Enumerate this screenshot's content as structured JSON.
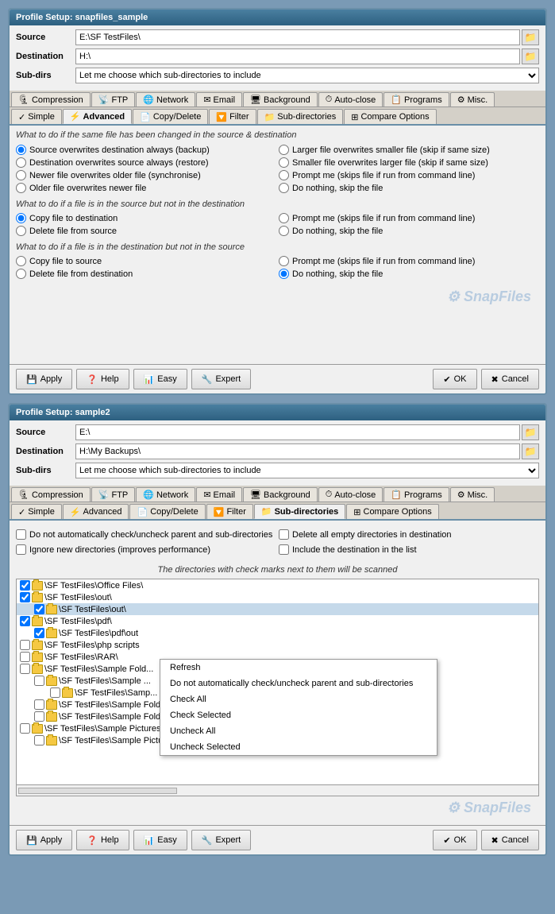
{
  "window1": {
    "title": "Profile Setup: snapfiles_sample",
    "source_label": "Source",
    "source_value": "E:\\SF TestFiles\\",
    "destination_label": "Destination",
    "destination_value": "H:\\",
    "subdirs_label": "Sub-dirs",
    "subdirs_value": "Let me choose which sub-directories to include",
    "tabs_row1": [
      {
        "label": "Compression",
        "icon": "🗜"
      },
      {
        "label": "FTP",
        "icon": "📡"
      },
      {
        "label": "Network",
        "icon": "🌐"
      },
      {
        "label": "Email",
        "icon": "✉"
      },
      {
        "label": "Background",
        "icon": "🖥"
      },
      {
        "label": "Auto-close",
        "icon": "⏱"
      },
      {
        "label": "Programs",
        "icon": "📋"
      },
      {
        "label": "Misc.",
        "icon": "⚙"
      }
    ],
    "tabs_row2": [
      {
        "label": "Simple",
        "icon": "✓",
        "active": false
      },
      {
        "label": "Advanced",
        "icon": "⚡",
        "active": true
      },
      {
        "label": "Copy/Delete",
        "icon": "📄",
        "active": false
      },
      {
        "label": "Filter",
        "icon": "🔽",
        "active": false
      },
      {
        "label": "Sub-directories",
        "icon": "📁",
        "active": false
      },
      {
        "label": "Compare Options",
        "icon": "⊞",
        "active": false
      }
    ],
    "section1_header": "What to do if the same file has been changed in the source & destination",
    "radio_groups": [
      {
        "options_left": [
          "Source overwrites destination always (backup)",
          "Destination overwrites source always (restore)",
          "Newer file overwrites older file (synchronise)",
          "Older file overwrites newer file"
        ],
        "options_right": [
          "Larger file overwrites smaller file (skip if same size)",
          "Smaller file overwrites larger file (skip if same size)",
          "Prompt me (skips file if run from command line)",
          "Do nothing, skip the file"
        ],
        "selected_left": 0,
        "selected_right": -1
      }
    ],
    "section2_header": "What to do if a file is in the source but not in the destination",
    "section2_left": [
      "Copy file to destination",
      "Delete file from source"
    ],
    "section2_right": [
      "Prompt me  (skips file if run from command line)",
      "Do nothing, skip the file"
    ],
    "section2_selected_left": 0,
    "section3_header": "What to do if a file is in the destination but not in the source",
    "section3_left": [
      "Copy file to source",
      "Delete file from destination"
    ],
    "section3_right": [
      "Prompt me  (skips file if run from command line)",
      "Do nothing, skip the file"
    ],
    "section3_selected_right": 1,
    "buttons": {
      "apply": "Apply",
      "help": "Help",
      "easy": "Easy",
      "expert": "Expert",
      "ok": "OK",
      "cancel": "Cancel"
    },
    "watermark": "SnapFiles"
  },
  "window2": {
    "title": "Profile Setup: sample2",
    "source_label": "Source",
    "source_value": "E:\\",
    "destination_label": "Destination",
    "destination_value": "H:\\My Backups\\",
    "subdirs_label": "Sub-dirs",
    "subdirs_value": "Let me choose which sub-directories to include",
    "tabs_row1": [
      {
        "label": "Compression",
        "icon": "🗜"
      },
      {
        "label": "FTP",
        "icon": "📡"
      },
      {
        "label": "Network",
        "icon": "🌐"
      },
      {
        "label": "Email",
        "icon": "✉"
      },
      {
        "label": "Background",
        "icon": "🖥"
      },
      {
        "label": "Auto-close",
        "icon": "⏱"
      },
      {
        "label": "Programs",
        "icon": "📋"
      },
      {
        "label": "Misc.",
        "icon": "⚙"
      }
    ],
    "tabs_row2": [
      {
        "label": "Simple",
        "icon": "✓",
        "active": false
      },
      {
        "label": "Advanced",
        "icon": "⚡",
        "active": false
      },
      {
        "label": "Copy/Delete",
        "icon": "📄",
        "active": false
      },
      {
        "label": "Filter",
        "icon": "🔽",
        "active": false
      },
      {
        "label": "Sub-directories",
        "icon": "📁",
        "active": true
      },
      {
        "label": "Compare Options",
        "icon": "⊞",
        "active": false
      }
    ],
    "checkboxes_top": [
      {
        "label": "Do not automatically check/uncheck parent and sub-directories",
        "checked": false
      },
      {
        "label": "Delete all empty directories in destination",
        "checked": false
      },
      {
        "label": "Ignore new directories (improves performance)",
        "checked": false
      },
      {
        "label": "Include the destination in the list",
        "checked": false
      }
    ],
    "dir_note": "The directories with check marks next to them will be scanned",
    "tree_items": [
      {
        "indent": 0,
        "checked": true,
        "label": "\\SF TestFiles\\Office Files\\"
      },
      {
        "indent": 0,
        "checked": true,
        "label": "\\SF TestFiles\\out\\"
      },
      {
        "indent": 1,
        "checked": true,
        "label": "\\SF TestFiles\\out\\",
        "highlighted": true
      },
      {
        "indent": 0,
        "checked": true,
        "label": "\\SF TestFiles\\pdf\\"
      },
      {
        "indent": 1,
        "checked": true,
        "label": "\\SF TestFiles\\pdf\\out"
      },
      {
        "indent": 0,
        "checked": false,
        "label": "\\SF TestFiles\\php scripts"
      },
      {
        "indent": 0,
        "checked": false,
        "label": "\\SF TestFiles\\RAR\\"
      },
      {
        "indent": 0,
        "checked": false,
        "label": "\\SF TestFiles\\Sample Fold..."
      },
      {
        "indent": 1,
        "checked": false,
        "label": "\\SF TestFiles\\Sample ..."
      },
      {
        "indent": 2,
        "checked": false,
        "label": "\\SF TestFiles\\Samp..."
      },
      {
        "indent": 1,
        "checked": false,
        "label": "\\SF TestFiles\\Sample Folder\\(smth)"
      },
      {
        "indent": 1,
        "checked": false,
        "label": "\\SF TestFiles\\Sample Folder\\photos\\"
      },
      {
        "indent": 0,
        "checked": false,
        "label": "\\SF TestFiles\\Sample Pictures\\"
      },
      {
        "indent": 1,
        "checked": false,
        "label": "\\SF TestFiles\\Sample Pictures\\Archive\\"
      }
    ],
    "context_menu": {
      "items": [
        {
          "label": "Refresh",
          "separator_after": false
        },
        {
          "label": "Do not automatically check/uncheck parent and sub-directories",
          "separator_after": false
        },
        {
          "label": "Check All",
          "separator_after": false
        },
        {
          "label": "Check Selected",
          "separator_after": false
        },
        {
          "label": "Uncheck All",
          "separator_after": false
        },
        {
          "label": "Uncheck Selected",
          "separator_after": false
        }
      ]
    },
    "buttons": {
      "apply": "Apply",
      "help": "Help",
      "easy": "Easy",
      "expert": "Expert",
      "ok": "OK",
      "cancel": "Cancel"
    },
    "watermark": "SnapFiles"
  }
}
